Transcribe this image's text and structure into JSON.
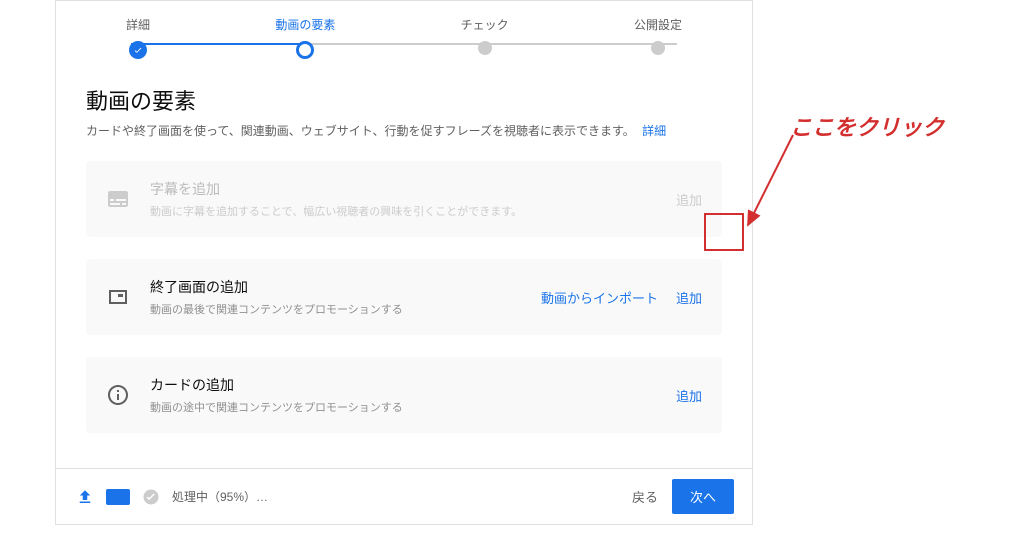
{
  "stepper": {
    "steps": [
      {
        "label": "詳細",
        "state": "done"
      },
      {
        "label": "動画の要素",
        "state": "current"
      },
      {
        "label": "チェック",
        "state": "pending"
      },
      {
        "label": "公開設定",
        "state": "pending"
      }
    ]
  },
  "page": {
    "title": "動画の要素",
    "description": "カードや終了画面を使って、関連動画、ウェブサイト、行動を促すフレーズを視聴者に表示できます。",
    "learn_more": "詳細"
  },
  "cards": {
    "subtitles": {
      "title": "字幕を追加",
      "desc": "動画に字幕を追加することで、幅広い視聴者の興味を引くことができます。",
      "add": "追加"
    },
    "endscreen": {
      "title": "終了画面の追加",
      "desc": "動画の最後で関連コンテンツをプロモーションする",
      "import": "動画からインポート",
      "add": "追加"
    },
    "infocards": {
      "title": "カードの追加",
      "desc": "動画の途中で関連コンテンツをプロモーションする",
      "add": "追加"
    }
  },
  "footer": {
    "status": "処理中（95%）…",
    "back": "戻る",
    "next": "次へ"
  },
  "annotation": {
    "text": "ここをクリック"
  }
}
